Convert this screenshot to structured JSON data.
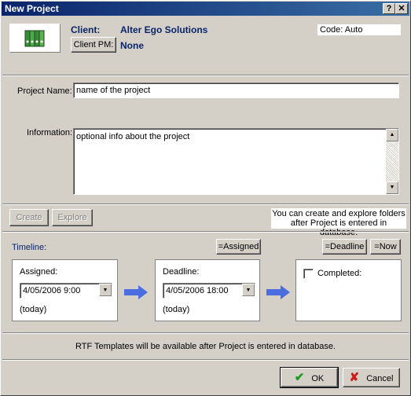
{
  "window": {
    "title": "New Project",
    "help_btn": "?",
    "close_btn": "✕"
  },
  "header": {
    "client_label": "Client:",
    "client_name": "Alter Ego Solutions",
    "client_pm_button": "Client PM:",
    "client_pm_value": "None",
    "code_text": "Code: Auto",
    "logo_icon": "binders-icon"
  },
  "project": {
    "name_label": "Project Name:",
    "name_value": "name of the project",
    "info_label": "Information:",
    "info_value": "optional info about the project"
  },
  "folders": {
    "create_button": "Create",
    "explore_button": "Explore",
    "note": "You can create and explore folders after Project is entered in database."
  },
  "timeline": {
    "label": "Timeline:",
    "assigned_btn": "=Assigned",
    "deadline_btn": "=Deadline",
    "now_btn": "=Now",
    "assigned": {
      "label": "Assigned:",
      "value": "4/05/2006 9:00",
      "relative": "(today)"
    },
    "deadline": {
      "label": "Deadline:",
      "value": "4/05/2006 18:00",
      "relative": "(today)"
    },
    "completed_label": "Completed:"
  },
  "templates_note": "RTF Templates will be available after Project is entered in database.",
  "footer": {
    "ok_button": "OK",
    "cancel_button": "Cancel"
  },
  "colors": {
    "title_bar": "#0a246a",
    "client_text": "#0a246a",
    "arrow": "#4a6ee0",
    "ok_check": "#1a9a1a",
    "cancel_x": "#cc1a1a"
  }
}
